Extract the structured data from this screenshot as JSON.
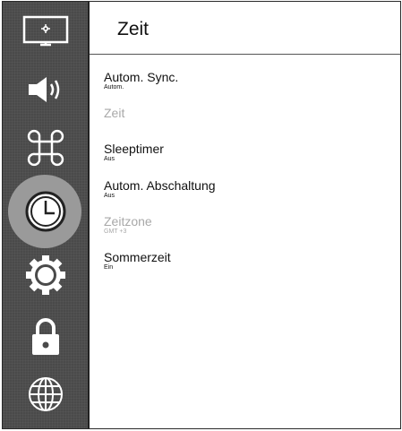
{
  "header": {
    "title": "Zeit"
  },
  "sidebar": {
    "items": [
      {
        "icon": "monitor-settings-icon"
      },
      {
        "icon": "speaker-icon"
      },
      {
        "icon": "command-icon"
      },
      {
        "icon": "clock-icon",
        "selected": true
      },
      {
        "icon": "gear-icon"
      },
      {
        "icon": "lock-icon"
      },
      {
        "icon": "globe-icon"
      }
    ]
  },
  "menu": {
    "items": [
      {
        "label": "Autom. Sync.",
        "value": "Autom.",
        "enabled": true
      },
      {
        "label": "Zeit",
        "value": "",
        "enabled": false
      },
      {
        "label": "Sleeptimer",
        "value": "Aus",
        "enabled": true
      },
      {
        "label": "Autom. Abschaltung",
        "value": "Aus",
        "enabled": true
      },
      {
        "label": "Zeitzone",
        "value": "GMT +3",
        "enabled": false
      },
      {
        "label": "Sommerzeit",
        "value": "Ein",
        "enabled": true
      }
    ]
  },
  "colors": {
    "sidebar": "#4a4a4a",
    "selected": "#9a9a9a",
    "disabled_text": "#a8a8a8",
    "text": "#111111"
  }
}
